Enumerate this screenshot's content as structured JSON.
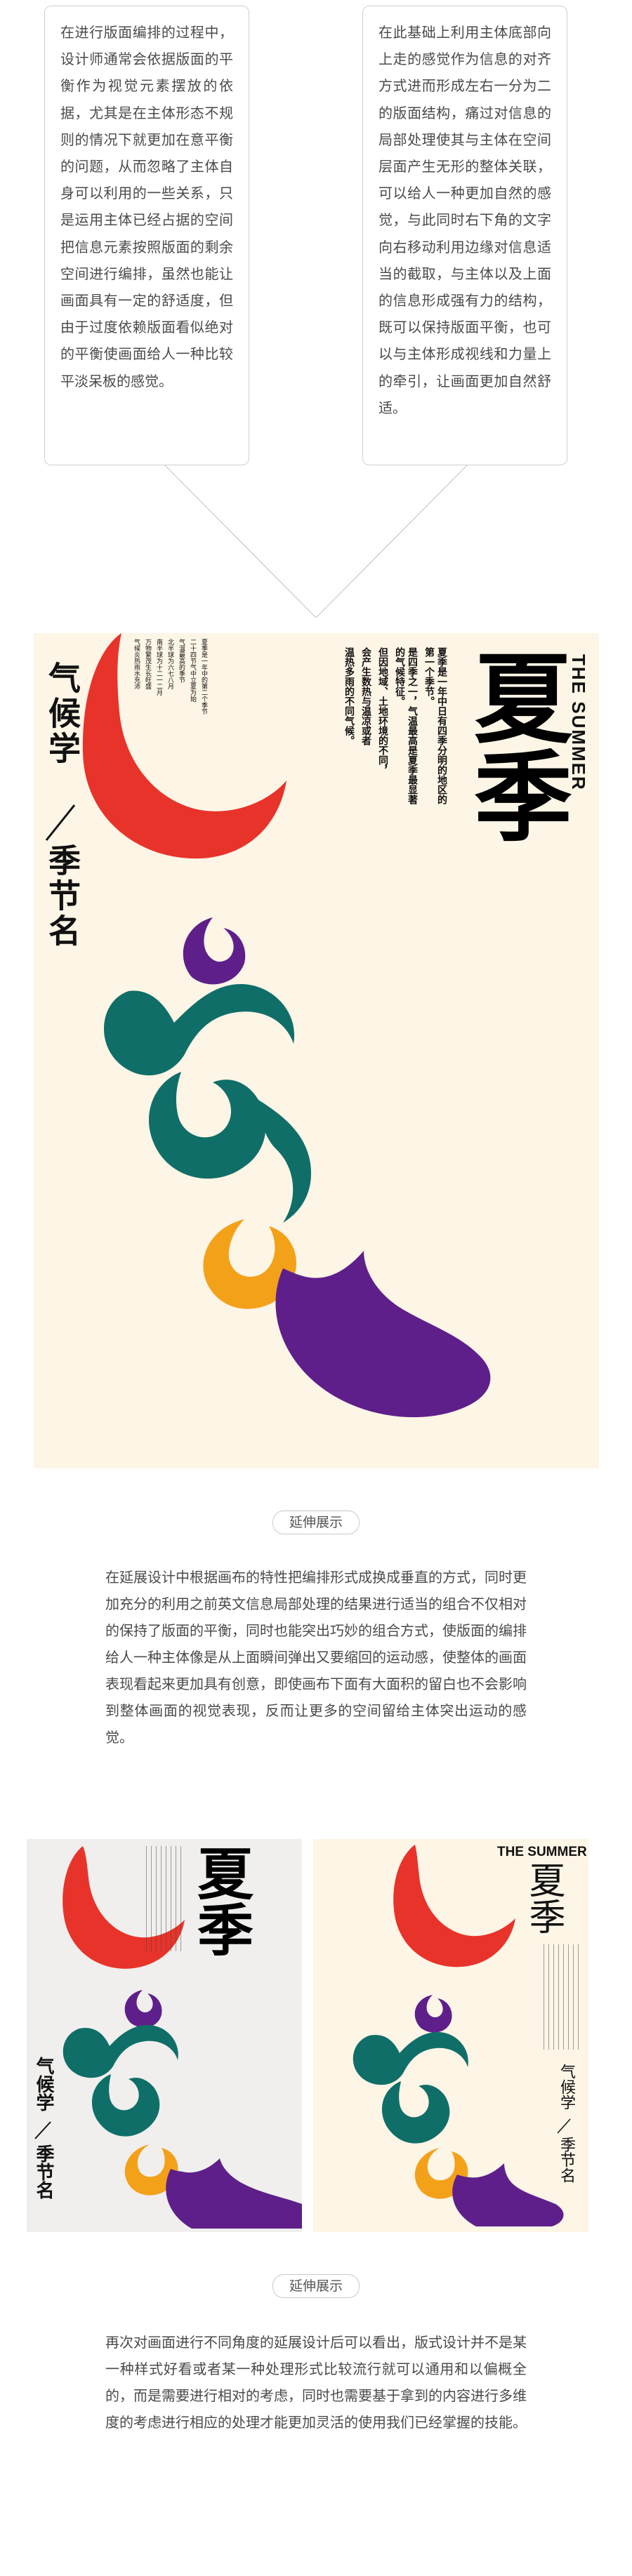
{
  "callouts": {
    "left": "在进行版面编排的过程中，设计师通常会依据版面的平衡作为视觉元素摆放的依据，尤其是在主体形态不规则的情况下就更加在意平衡的问题，从而忽略了主体自身可以利用的一些关系，只是运用主体已经占据的空间把信息元素按照版面的剩余空间进行编排，虽然也能让画面具有一定的舒适度，但由于过度依赖版面看似绝对的平衡使画面给人一种比较平淡呆板的感觉。",
    "right": "在此基础上利用主体底部向上走的感觉作为信息的对齐方式进而形成左右一分为二的版面结构，痛过对信息的局部处理使其与主体在空间层面产生无形的整体关联，可以给人一种更加自然的感觉，与此同时右下角的文字向右移动利用边缘对信息适当的截取，与主体以及上面的信息形成强有力的结构，既可以保持版面平衡，也可以与主体形成视线和力量上的牵引，让画面更加自然舒适。"
  },
  "poster_main": {
    "title_cn": "夏季",
    "title_en": "THE SUMMER",
    "side_title_1": "气候学",
    "side_title_2": "季节名",
    "body_cols": [
      "夏季是一年中日有四季分明的地区的第一个季节。",
      "是四季之一，气温最高是夏季最显著的气候特征。",
      "但因地域、土地环境的不同，",
      "会产生数热与温凉或者",
      "温热多雨的不同气候。"
    ],
    "small_cols": [
      "夏季是一年中的第二个季节",
      "二十四节气中立夏为始",
      "气温最高的季节",
      "北半球为六七八月",
      "南半球为十二一二月",
      "万物繁茂生长旺盛",
      "气候炎热雨水充沛"
    ]
  },
  "section1": {
    "pill": "延伸展示",
    "paragraph": "在延展设计中根据画布的特性把编排形式成换成垂直的方式，同时更加充分的利用之前英文信息局部处理的结果进行适当的组合不仅相对的保持了版面的平衡，同时也能突出巧妙的组合方式，使版面的编排给人一种主体像是从上面瞬间弹出又要缩回的运动感，使整体的画面表现看起来更加具有创意，即使画布下面有大面积的留白也不会影响到整体画面的视觉表现，反而让更多的空间留给主体突出运动的感觉。"
  },
  "poster_left": {
    "title_cn": "夏季",
    "side_title_1": "气候学",
    "side_title_2": "季节名"
  },
  "poster_right": {
    "title_en": "THE SUMMER",
    "title_cn": "夏季",
    "side_title_1": "气候学",
    "side_title_2": "季节名"
  },
  "section2": {
    "pill": "延伸展示",
    "paragraph": "再次对画面进行不同角度的延展设计后可以看出，版式设计并不是某一种样式好看或者某一种处理形式比较流行就可以通用和以偏概全的，而是需要进行相对的考虑，同时也需要基于拿到的内容进行多维度的考虑进行相应的处理才能更加灵活的使用我们已经掌握的技能。"
  },
  "colors": {
    "red": "#e8332a",
    "purple": "#5e1f8a",
    "teal": "#0f6e68",
    "orange": "#f4a11a",
    "poster_bg": "#fdf5e6",
    "poster_bg_gray": "#f0efee"
  }
}
